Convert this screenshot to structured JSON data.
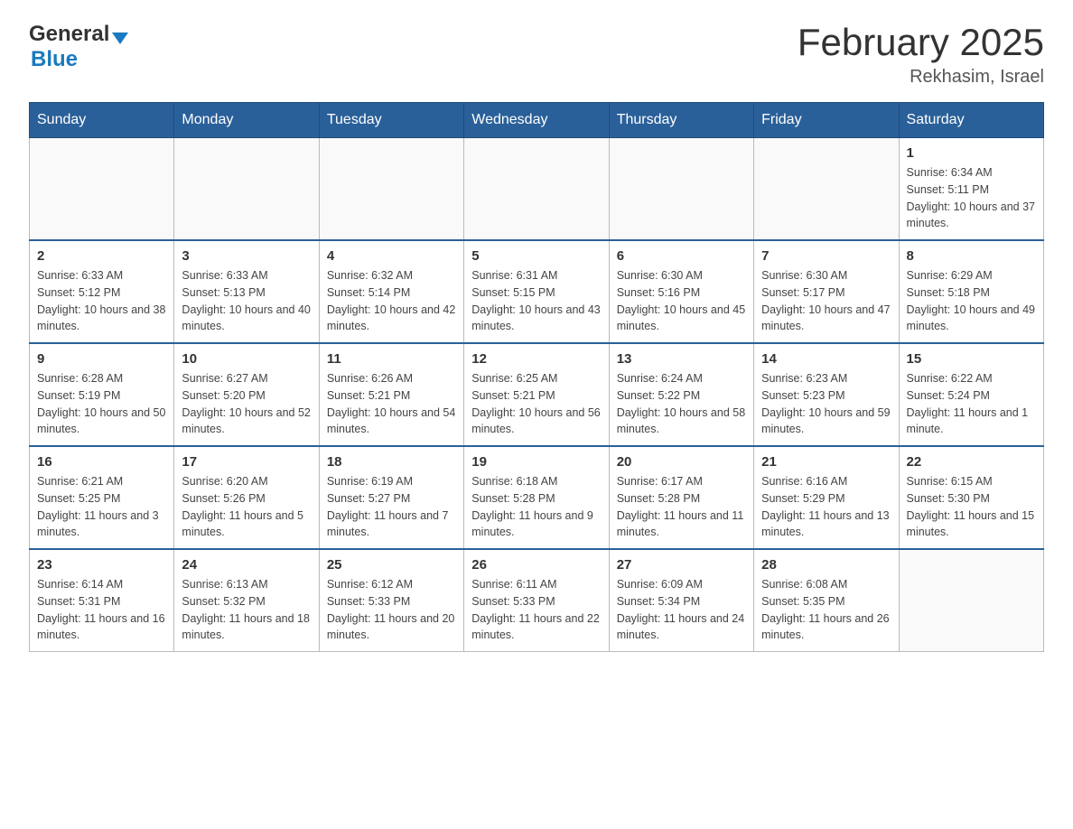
{
  "logo": {
    "general": "General",
    "blue": "Blue",
    "arrow_color": "#1a7abf"
  },
  "title": "February 2025",
  "subtitle": "Rekhasim, Israel",
  "days_header": [
    "Sunday",
    "Monday",
    "Tuesday",
    "Wednesday",
    "Thursday",
    "Friday",
    "Saturday"
  ],
  "weeks": [
    [
      {
        "day": "",
        "sunrise": "",
        "sunset": "",
        "daylight": ""
      },
      {
        "day": "",
        "sunrise": "",
        "sunset": "",
        "daylight": ""
      },
      {
        "day": "",
        "sunrise": "",
        "sunset": "",
        "daylight": ""
      },
      {
        "day": "",
        "sunrise": "",
        "sunset": "",
        "daylight": ""
      },
      {
        "day": "",
        "sunrise": "",
        "sunset": "",
        "daylight": ""
      },
      {
        "day": "",
        "sunrise": "",
        "sunset": "",
        "daylight": ""
      },
      {
        "day": "1",
        "sunrise": "Sunrise: 6:34 AM",
        "sunset": "Sunset: 5:11 PM",
        "daylight": "Daylight: 10 hours and 37 minutes."
      }
    ],
    [
      {
        "day": "2",
        "sunrise": "Sunrise: 6:33 AM",
        "sunset": "Sunset: 5:12 PM",
        "daylight": "Daylight: 10 hours and 38 minutes."
      },
      {
        "day": "3",
        "sunrise": "Sunrise: 6:33 AM",
        "sunset": "Sunset: 5:13 PM",
        "daylight": "Daylight: 10 hours and 40 minutes."
      },
      {
        "day": "4",
        "sunrise": "Sunrise: 6:32 AM",
        "sunset": "Sunset: 5:14 PM",
        "daylight": "Daylight: 10 hours and 42 minutes."
      },
      {
        "day": "5",
        "sunrise": "Sunrise: 6:31 AM",
        "sunset": "Sunset: 5:15 PM",
        "daylight": "Daylight: 10 hours and 43 minutes."
      },
      {
        "day": "6",
        "sunrise": "Sunrise: 6:30 AM",
        "sunset": "Sunset: 5:16 PM",
        "daylight": "Daylight: 10 hours and 45 minutes."
      },
      {
        "day": "7",
        "sunrise": "Sunrise: 6:30 AM",
        "sunset": "Sunset: 5:17 PM",
        "daylight": "Daylight: 10 hours and 47 minutes."
      },
      {
        "day": "8",
        "sunrise": "Sunrise: 6:29 AM",
        "sunset": "Sunset: 5:18 PM",
        "daylight": "Daylight: 10 hours and 49 minutes."
      }
    ],
    [
      {
        "day": "9",
        "sunrise": "Sunrise: 6:28 AM",
        "sunset": "Sunset: 5:19 PM",
        "daylight": "Daylight: 10 hours and 50 minutes."
      },
      {
        "day": "10",
        "sunrise": "Sunrise: 6:27 AM",
        "sunset": "Sunset: 5:20 PM",
        "daylight": "Daylight: 10 hours and 52 minutes."
      },
      {
        "day": "11",
        "sunrise": "Sunrise: 6:26 AM",
        "sunset": "Sunset: 5:21 PM",
        "daylight": "Daylight: 10 hours and 54 minutes."
      },
      {
        "day": "12",
        "sunrise": "Sunrise: 6:25 AM",
        "sunset": "Sunset: 5:21 PM",
        "daylight": "Daylight: 10 hours and 56 minutes."
      },
      {
        "day": "13",
        "sunrise": "Sunrise: 6:24 AM",
        "sunset": "Sunset: 5:22 PM",
        "daylight": "Daylight: 10 hours and 58 minutes."
      },
      {
        "day": "14",
        "sunrise": "Sunrise: 6:23 AM",
        "sunset": "Sunset: 5:23 PM",
        "daylight": "Daylight: 10 hours and 59 minutes."
      },
      {
        "day": "15",
        "sunrise": "Sunrise: 6:22 AM",
        "sunset": "Sunset: 5:24 PM",
        "daylight": "Daylight: 11 hours and 1 minute."
      }
    ],
    [
      {
        "day": "16",
        "sunrise": "Sunrise: 6:21 AM",
        "sunset": "Sunset: 5:25 PM",
        "daylight": "Daylight: 11 hours and 3 minutes."
      },
      {
        "day": "17",
        "sunrise": "Sunrise: 6:20 AM",
        "sunset": "Sunset: 5:26 PM",
        "daylight": "Daylight: 11 hours and 5 minutes."
      },
      {
        "day": "18",
        "sunrise": "Sunrise: 6:19 AM",
        "sunset": "Sunset: 5:27 PM",
        "daylight": "Daylight: 11 hours and 7 minutes."
      },
      {
        "day": "19",
        "sunrise": "Sunrise: 6:18 AM",
        "sunset": "Sunset: 5:28 PM",
        "daylight": "Daylight: 11 hours and 9 minutes."
      },
      {
        "day": "20",
        "sunrise": "Sunrise: 6:17 AM",
        "sunset": "Sunset: 5:28 PM",
        "daylight": "Daylight: 11 hours and 11 minutes."
      },
      {
        "day": "21",
        "sunrise": "Sunrise: 6:16 AM",
        "sunset": "Sunset: 5:29 PM",
        "daylight": "Daylight: 11 hours and 13 minutes."
      },
      {
        "day": "22",
        "sunrise": "Sunrise: 6:15 AM",
        "sunset": "Sunset: 5:30 PM",
        "daylight": "Daylight: 11 hours and 15 minutes."
      }
    ],
    [
      {
        "day": "23",
        "sunrise": "Sunrise: 6:14 AM",
        "sunset": "Sunset: 5:31 PM",
        "daylight": "Daylight: 11 hours and 16 minutes."
      },
      {
        "day": "24",
        "sunrise": "Sunrise: 6:13 AM",
        "sunset": "Sunset: 5:32 PM",
        "daylight": "Daylight: 11 hours and 18 minutes."
      },
      {
        "day": "25",
        "sunrise": "Sunrise: 6:12 AM",
        "sunset": "Sunset: 5:33 PM",
        "daylight": "Daylight: 11 hours and 20 minutes."
      },
      {
        "day": "26",
        "sunrise": "Sunrise: 6:11 AM",
        "sunset": "Sunset: 5:33 PM",
        "daylight": "Daylight: 11 hours and 22 minutes."
      },
      {
        "day": "27",
        "sunrise": "Sunrise: 6:09 AM",
        "sunset": "Sunset: 5:34 PM",
        "daylight": "Daylight: 11 hours and 24 minutes."
      },
      {
        "day": "28",
        "sunrise": "Sunrise: 6:08 AM",
        "sunset": "Sunset: 5:35 PM",
        "daylight": "Daylight: 11 hours and 26 minutes."
      },
      {
        "day": "",
        "sunrise": "",
        "sunset": "",
        "daylight": ""
      }
    ]
  ]
}
